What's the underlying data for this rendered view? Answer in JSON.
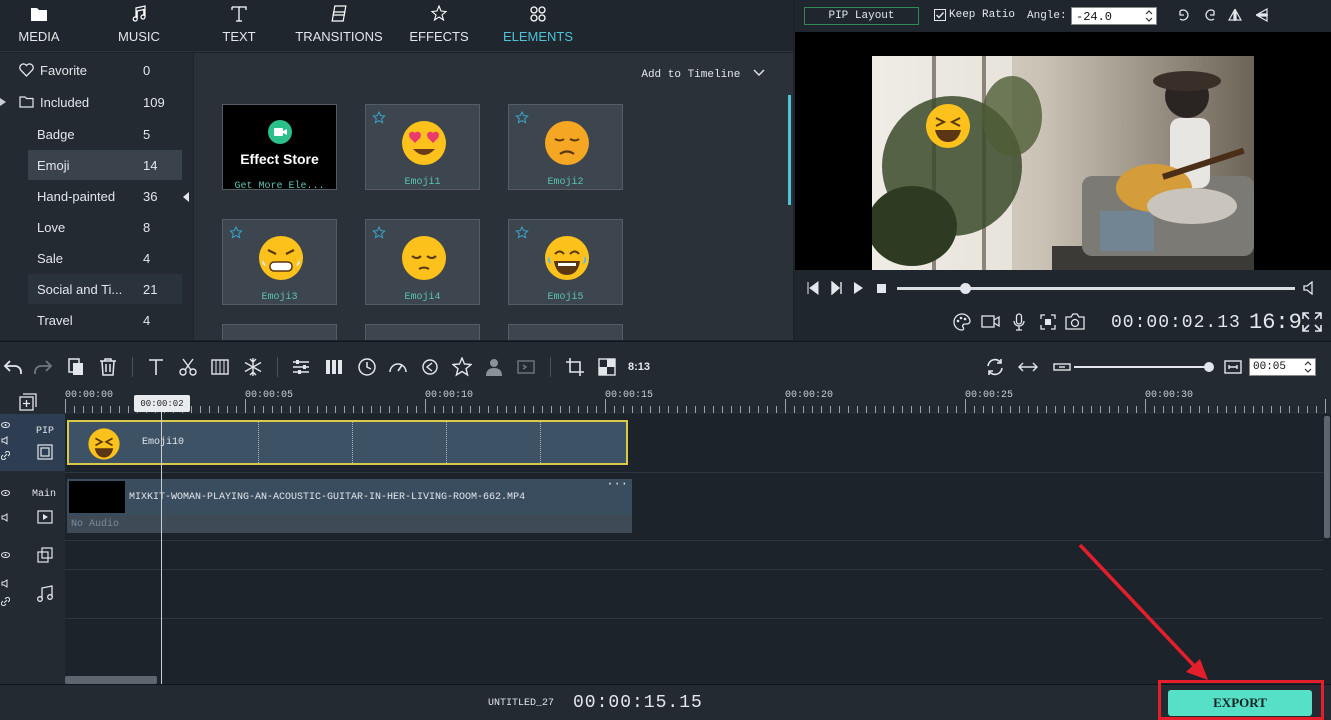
{
  "tabs": [
    {
      "label": "MEDIA",
      "icon": "folder-icon"
    },
    {
      "label": "MUSIC",
      "icon": "music-icon"
    },
    {
      "label": "TEXT",
      "icon": "text-icon"
    },
    {
      "label": "TRANSITIONS",
      "icon": "transitions-icon"
    },
    {
      "label": "EFFECTS",
      "icon": "effects-icon"
    },
    {
      "label": "ELEMENTS",
      "icon": "elements-icon"
    }
  ],
  "categories": [
    {
      "label": "Favorite",
      "count": "0"
    },
    {
      "label": "Included",
      "count": "109"
    },
    {
      "label": "Badge",
      "count": "5"
    },
    {
      "label": "Emoji",
      "count": "14"
    },
    {
      "label": "Hand-painted",
      "count": "36"
    },
    {
      "label": "Love",
      "count": "8"
    },
    {
      "label": "Sale",
      "count": "4"
    },
    {
      "label": "Social and Ti...",
      "count": "21"
    },
    {
      "label": "Travel",
      "count": "4"
    }
  ],
  "grid": {
    "add_to_timeline": "Add to Timeline",
    "store_title": "Effect Store",
    "store_caption": "Get More Ele...",
    "items": [
      "Emoji1",
      "Emoji2",
      "Emoji3",
      "Emoji4",
      "Emoji5"
    ]
  },
  "preview": {
    "pip_layout": "PIP Layout",
    "keep_ratio": "Keep Ratio",
    "angle_label": "Angle:",
    "angle_value": "-24.0",
    "timecode": "00:00:02.13",
    "aspect": "16:9",
    "progress": 0.17
  },
  "timeline": {
    "zoom_value": "00:05",
    "ratio_label": "8:13",
    "ruler": [
      "00:00:00",
      "00:00:05",
      "00:00:10",
      "00:00:15",
      "00:00:20",
      "00:00:25",
      "00:00:30"
    ],
    "playhead": "00:00:02",
    "pip_track": "PIP",
    "main_track": "Main",
    "pip_clip": "Emoji10",
    "main_clip": "MIXKIT-WOMAN-PLAYING-AN-ACOUSTIC-GUITAR-IN-HER-LIVING-ROOM-662.MP4",
    "no_audio": "No Audio"
  },
  "bottom": {
    "project": "UNTITLED_27",
    "duration": "00:00:15.15",
    "export": "EXPORT"
  },
  "colors": {
    "accent": "#4fc3d6",
    "export": "#56e0c7",
    "highlight": "#e41f2b",
    "clip_border": "#d9c94a"
  }
}
